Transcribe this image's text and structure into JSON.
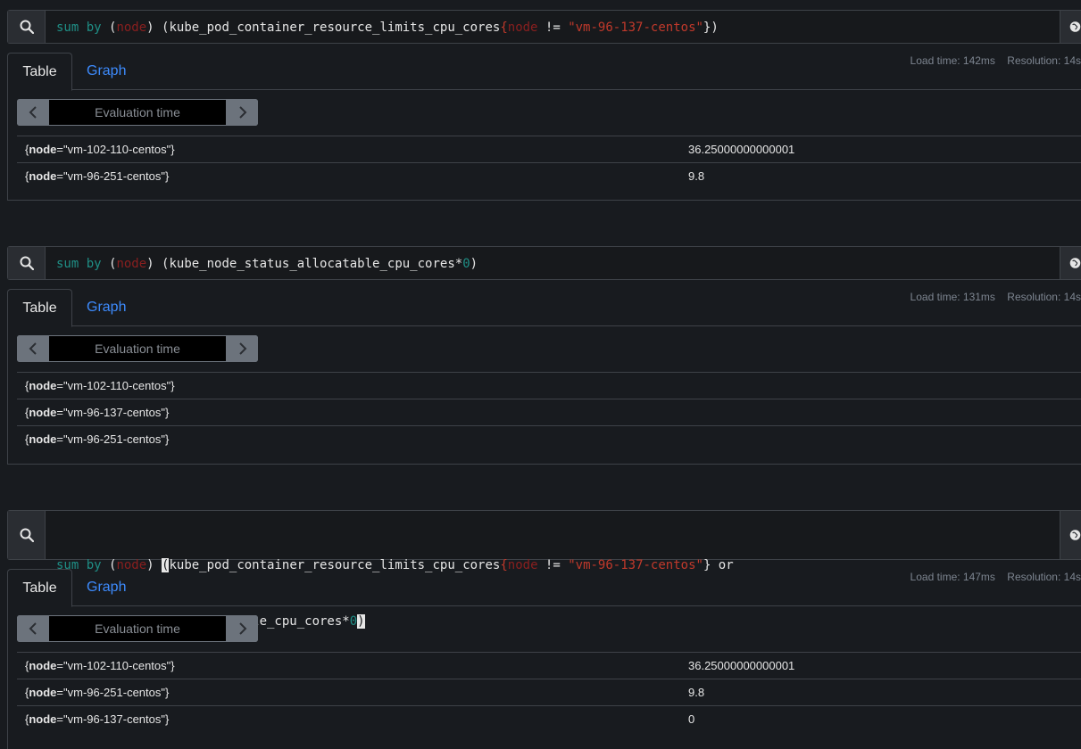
{
  "panels": [
    {
      "query": {
        "parts": [
          [
            "kw",
            "sum by "
          ],
          [
            "paren",
            "("
          ],
          [
            "lbl",
            "node"
          ],
          [
            "paren",
            ") (kube_pod_container_resource_limits_cpu_cores"
          ],
          [
            "str",
            "{"
          ],
          [
            "lbl",
            "node"
          ],
          [
            "paren",
            " != "
          ],
          [
            "str",
            "\"vm-96-137-centos\""
          ],
          [
            "paren",
            "})"
          ]
        ]
      },
      "tabs": {
        "table": "Table",
        "graph": "Graph"
      },
      "load_time": "Load time: 142ms",
      "resolution": "Resolution: 14s",
      "eval_placeholder": "Evaluation time",
      "rows": [
        {
          "label_key": "node",
          "label_value": "\"vm-102-110-centos\"",
          "value": "36.25000000000001"
        },
        {
          "label_key": "node",
          "label_value": "\"vm-96-251-centos\"",
          "value": "9.8"
        }
      ]
    },
    {
      "query": {
        "parts": [
          [
            "kw",
            "sum by "
          ],
          [
            "paren",
            "("
          ],
          [
            "lbl",
            "node"
          ],
          [
            "paren",
            ") (kube_node_status_allocatable_cpu_cores*"
          ],
          [
            "num",
            "0"
          ],
          [
            "paren",
            ")"
          ]
        ]
      },
      "tabs": {
        "table": "Table",
        "graph": "Graph"
      },
      "load_time": "Load time: 131ms",
      "resolution": "Resolution: 14s",
      "eval_placeholder": "Evaluation time",
      "rows": [
        {
          "label_key": "node",
          "label_value": "\"vm-102-110-centos\"",
          "value": ""
        },
        {
          "label_key": "node",
          "label_value": "\"vm-96-137-centos\"",
          "value": ""
        },
        {
          "label_key": "node",
          "label_value": "\"vm-96-251-centos\"",
          "value": ""
        }
      ]
    },
    {
      "query": {
        "line1": [
          [
            "kw",
            "sum by "
          ],
          [
            "paren",
            "("
          ],
          [
            "lbl",
            "node"
          ],
          [
            "paren",
            ") "
          ],
          [
            "cursor",
            "("
          ],
          [
            "paren",
            "kube_pod_container_resource_limits_cpu_cores"
          ],
          [
            "str",
            "{"
          ],
          [
            "lbl",
            "node"
          ],
          [
            "paren",
            " != "
          ],
          [
            "str",
            "\"vm-96-137-centos\""
          ],
          [
            "paren",
            "} or"
          ]
        ],
        "line2": [
          [
            "paren",
            "kube_node_status_allocatable_cpu_cores*"
          ],
          [
            "num",
            "0"
          ],
          [
            "cursor",
            ")"
          ]
        ]
      },
      "tabs": {
        "table": "Table",
        "graph": "Graph"
      },
      "load_time": "Load time: 147ms",
      "resolution": "Resolution: 14s",
      "eval_placeholder": "Evaluation time",
      "rows": [
        {
          "label_key": "node",
          "label_value": "\"vm-102-110-centos\"",
          "value": "36.25000000000001"
        },
        {
          "label_key": "node",
          "label_value": "\"vm-96-251-centos\"",
          "value": "9.8"
        },
        {
          "label_key": "node",
          "label_value": "\"vm-96-137-centos\"",
          "value": "0"
        }
      ]
    }
  ],
  "icons": {
    "search": "search-icon",
    "globe": "globe-icon",
    "prev": "chevron-left-icon",
    "next": "chevron-right-icon"
  }
}
